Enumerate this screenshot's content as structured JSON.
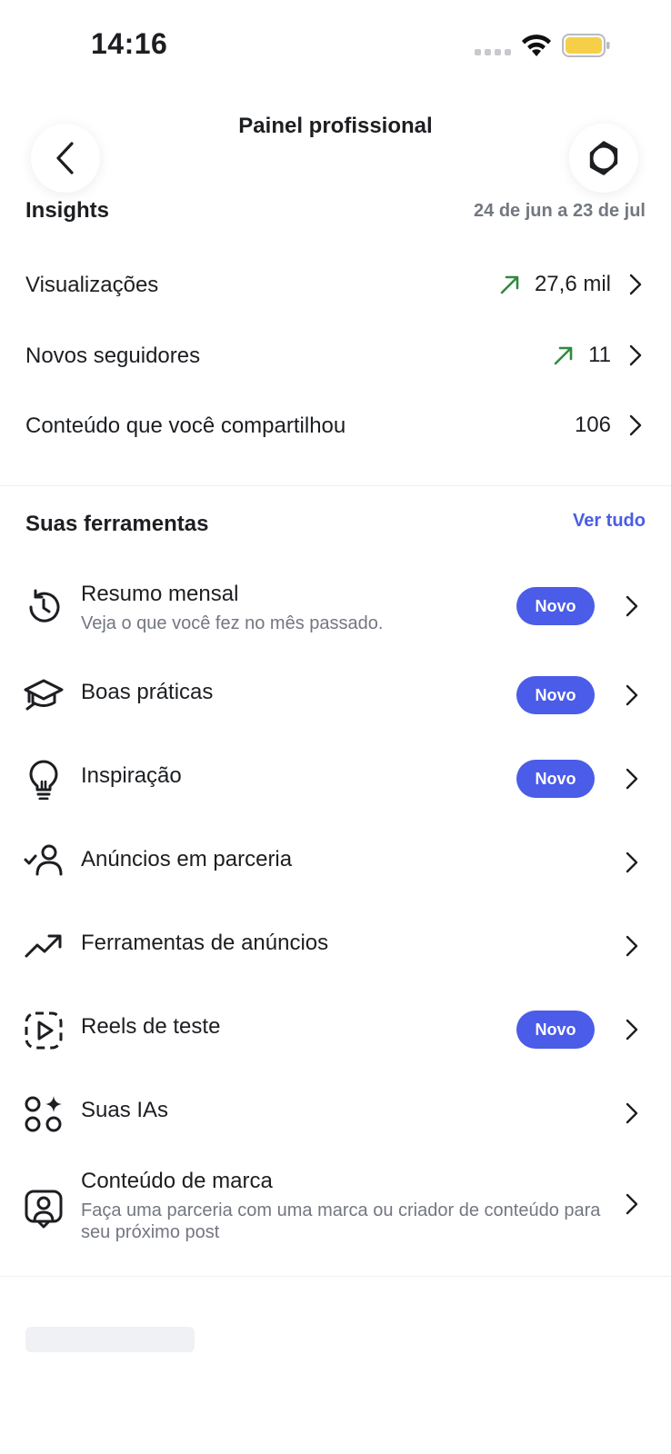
{
  "status_bar": {
    "time": "14:16"
  },
  "header": {
    "title": "Painel profissional"
  },
  "insights": {
    "title": "Insights",
    "date_range": "24 de jun a 23 de jul",
    "rows": [
      {
        "label": "Visualizações",
        "value": "27,6 mil",
        "trend": "up"
      },
      {
        "label": "Novos seguidores",
        "value": "11",
        "trend": "up"
      },
      {
        "label": "Conteúdo que você compartilhou",
        "value": "106",
        "trend": "none"
      }
    ]
  },
  "tools": {
    "title": "Suas ferramentas",
    "see_all": "Ver tudo",
    "badge_label": "Novo",
    "items": [
      {
        "title": "Resumo mensal",
        "subtitle": "Veja o que você fez no mês passado.",
        "icon": "history-icon",
        "badge": true
      },
      {
        "title": "Boas práticas",
        "subtitle": "",
        "icon": "graduation-cap-icon",
        "badge": true
      },
      {
        "title": "Inspiração",
        "subtitle": "",
        "icon": "lightbulb-icon",
        "badge": true
      },
      {
        "title": "Anúncios em parceria",
        "subtitle": "",
        "icon": "person-check-icon",
        "badge": false
      },
      {
        "title": "Ferramentas de anúncios",
        "subtitle": "",
        "icon": "trend-up-icon",
        "badge": false
      },
      {
        "title": "Reels de teste",
        "subtitle": "",
        "icon": "reels-test-icon",
        "badge": true
      },
      {
        "title": "Suas IAs",
        "subtitle": "",
        "icon": "ai-sparkle-icon",
        "badge": false
      },
      {
        "title": "Conteúdo de marca",
        "subtitle": "Faça uma parceria com uma marca ou criador de conteúdo para seu próximo post",
        "icon": "branded-content-icon",
        "badge": false
      }
    ]
  },
  "colors": {
    "accent": "#4a5ce8",
    "trend_up": "#2e8b3e",
    "muted": "#737780",
    "battery": "#f5cf48"
  }
}
